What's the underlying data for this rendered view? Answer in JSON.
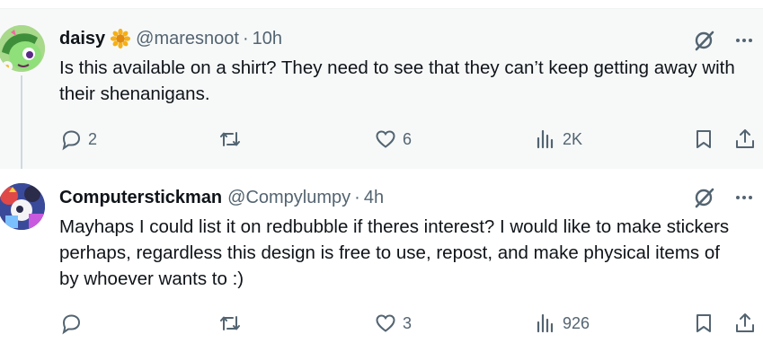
{
  "replies": [
    {
      "display_name": "daisy",
      "name_emoji": "sunflower",
      "handle": "@maresnoot",
      "separator": "·",
      "time": "10h",
      "text": "Is this available on a shirt? They need to see that they can’t keep getting away with their shenanigans.",
      "counts": {
        "replies": "2",
        "reposts": "",
        "likes": "6",
        "views": "2K"
      },
      "icons": {
        "grok": "grok-icon",
        "more": "more-icon"
      }
    },
    {
      "display_name": "Computerstickman",
      "handle": "@Compylumpy",
      "separator": "·",
      "time": "4h",
      "text": "Mayhaps I could list it on redbubble if theres interest? I would like to make stickers perhaps, regardless this design is free to use, repost, and make physical items of by whoever wants to :)",
      "counts": {
        "replies": "",
        "reposts": "",
        "likes": "3",
        "views": "926"
      },
      "icons": {
        "grok": "grok-icon",
        "more": "more-icon"
      }
    }
  ],
  "colors": {
    "text": "#0f1419",
    "secondary": "#536471",
    "highlight_bg": "#f7f9f9",
    "thread_line": "#cfd9de"
  }
}
